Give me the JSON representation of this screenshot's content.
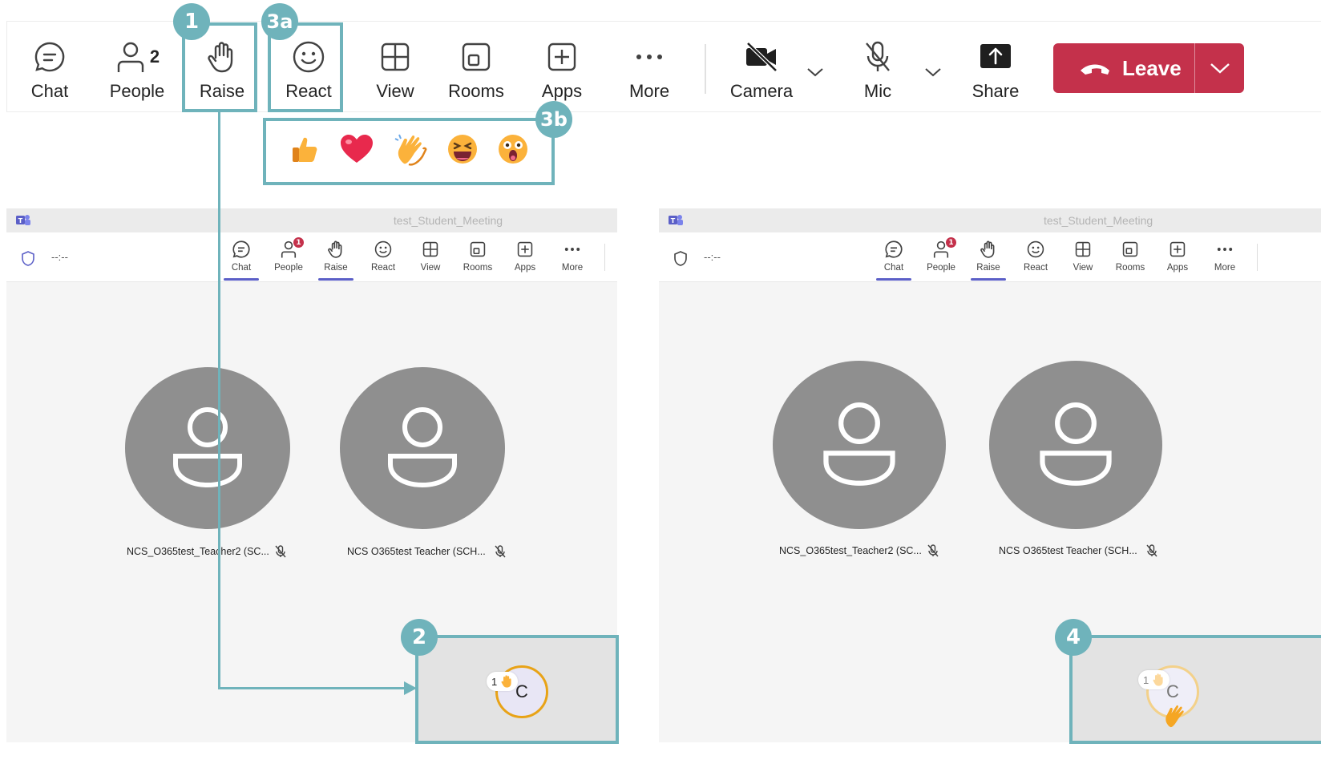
{
  "toolbar": {
    "chat_label": "Chat",
    "people_label": "People",
    "people_count": "2",
    "raise_label": "Raise",
    "react_label": "React",
    "view_label": "View",
    "rooms_label": "Rooms",
    "apps_label": "Apps",
    "more_label": "More",
    "camera_label": "Camera",
    "mic_label": "Mic",
    "share_label": "Share",
    "leave_label": "Leave"
  },
  "annotations": {
    "badge_1": "1",
    "badge_2": "2",
    "badge_3a": "3a",
    "badge_3b": "3b",
    "badge_4": "4"
  },
  "reactions": [
    "like",
    "heart",
    "applause",
    "laugh",
    "surprised"
  ],
  "windows": [
    {
      "title": "test_Student_Meeting",
      "timer": "--:--",
      "buttons": [
        "Chat",
        "People",
        "Raise",
        "React",
        "View",
        "Rooms",
        "Apps",
        "More"
      ],
      "people_badge": "1",
      "participants": [
        "NCS_O365test_Teacher2 (SC...",
        "NCS O365test Teacher (SCH..."
      ],
      "self_initial": "C",
      "raised_count": "1"
    },
    {
      "title": "test_Student_Meeting",
      "timer": "--:--",
      "buttons": [
        "Chat",
        "People",
        "Raise",
        "React",
        "View",
        "Rooms",
        "Apps",
        "More"
      ],
      "people_badge": "1",
      "participants": [
        "NCS_O365test_Teacher2 (SC...",
        "NCS O365test Teacher (SCH..."
      ],
      "self_initial": "C",
      "raised_count": "1"
    }
  ],
  "colors": {
    "accent_annotation": "#6fb3bb",
    "leave_red": "#c4314b",
    "teams_purple": "#5b5fc7",
    "raised_hand_ring": "#e8a317"
  }
}
